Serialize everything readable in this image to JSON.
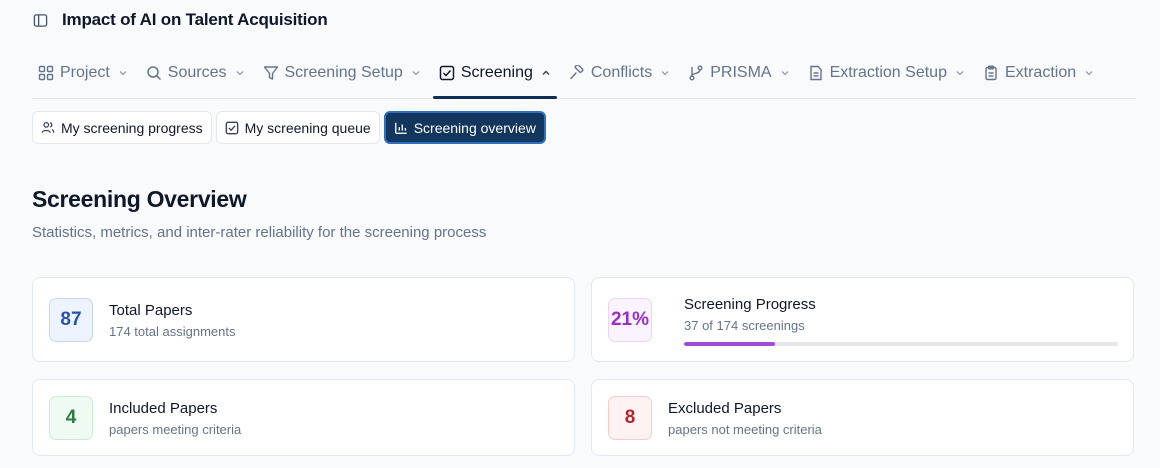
{
  "header": {
    "title": "Impact of AI on Talent Acquisition",
    "sidebar_icon": "sidebar-toggle-icon"
  },
  "nav": {
    "tabs": [
      {
        "label": "Project",
        "icon": "grid-icon",
        "chevron": "down",
        "active": false
      },
      {
        "label": "Sources",
        "icon": "search-icon",
        "chevron": "down",
        "active": false
      },
      {
        "label": "Screening Setup",
        "icon": "filter-icon",
        "chevron": "down",
        "active": false
      },
      {
        "label": "Screening",
        "icon": "checkbox-icon",
        "chevron": "up",
        "active": true
      },
      {
        "label": "Conflicts",
        "icon": "gavel-icon",
        "chevron": "down",
        "active": false
      },
      {
        "label": "PRISMA",
        "icon": "git-branch-icon",
        "chevron": "down",
        "active": false
      },
      {
        "label": "Extraction Setup",
        "icon": "document-icon",
        "chevron": "down",
        "active": false
      },
      {
        "label": "Extraction",
        "icon": "clipboard-icon",
        "chevron": "down",
        "active": false
      }
    ]
  },
  "subtabs": [
    {
      "label": "My screening progress",
      "icon": "users-icon",
      "active": false
    },
    {
      "label": "My screening queue",
      "icon": "checkbox-icon",
      "active": false
    },
    {
      "label": "Screening overview",
      "icon": "bar-chart-icon",
      "active": true
    }
  ],
  "overview": {
    "title": "Screening Overview",
    "subtitle": "Statistics, metrics, and inter-rater reliability for the screening process"
  },
  "cards": {
    "total": {
      "value": "87",
      "title": "Total Papers",
      "subtitle": "174 total assignments"
    },
    "progress": {
      "value": "21%",
      "title": "Screening Progress",
      "subtitle": "37 of 174 screenings",
      "fraction": 0.21
    },
    "included": {
      "value": "4",
      "title": "Included Papers",
      "subtitle": "papers meeting criteria"
    },
    "excluded": {
      "value": "8",
      "title": "Excluded Papers",
      "subtitle": "papers not meeting criteria"
    }
  },
  "colors": {
    "accent_dark": "#13365f",
    "blue": "#2754b0",
    "purple": "#9a2fc4",
    "green": "#2a7d3d",
    "red": "#b3262c"
  }
}
